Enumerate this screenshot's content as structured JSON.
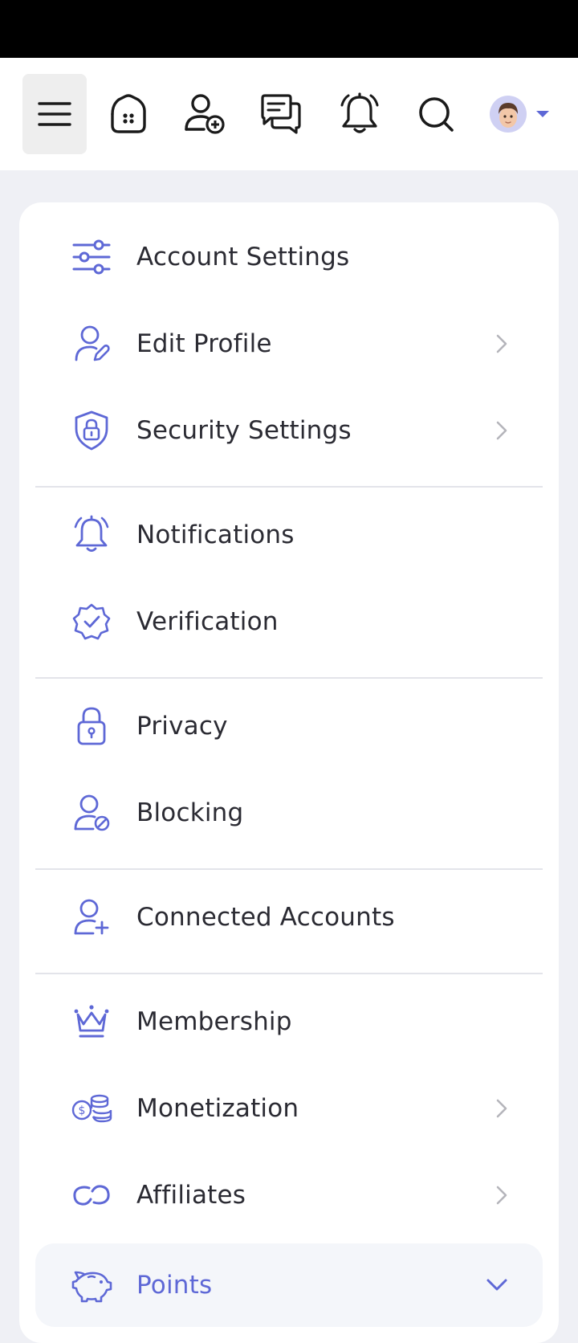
{
  "topbar": {
    "icons": [
      "menu-icon",
      "home-icon",
      "add-user-icon",
      "chat-icon",
      "bell-icon",
      "search-icon",
      "avatar",
      "caret-down-icon"
    ]
  },
  "settings_menu": {
    "account_settings": "Account Settings",
    "edit_profile": "Edit Profile",
    "security_settings": "Security Settings",
    "notifications": "Notifications",
    "verification": "Verification",
    "privacy": "Privacy",
    "blocking": "Blocking",
    "connected_accounts": "Connected Accounts",
    "membership": "Membership",
    "monetization": "Monetization",
    "affiliates": "Affiliates",
    "points": "Points"
  },
  "colors": {
    "accent": "#5e68d6",
    "text": "#2b2b33",
    "background": "#eff0f5",
    "divider": "#e3e4ea"
  }
}
